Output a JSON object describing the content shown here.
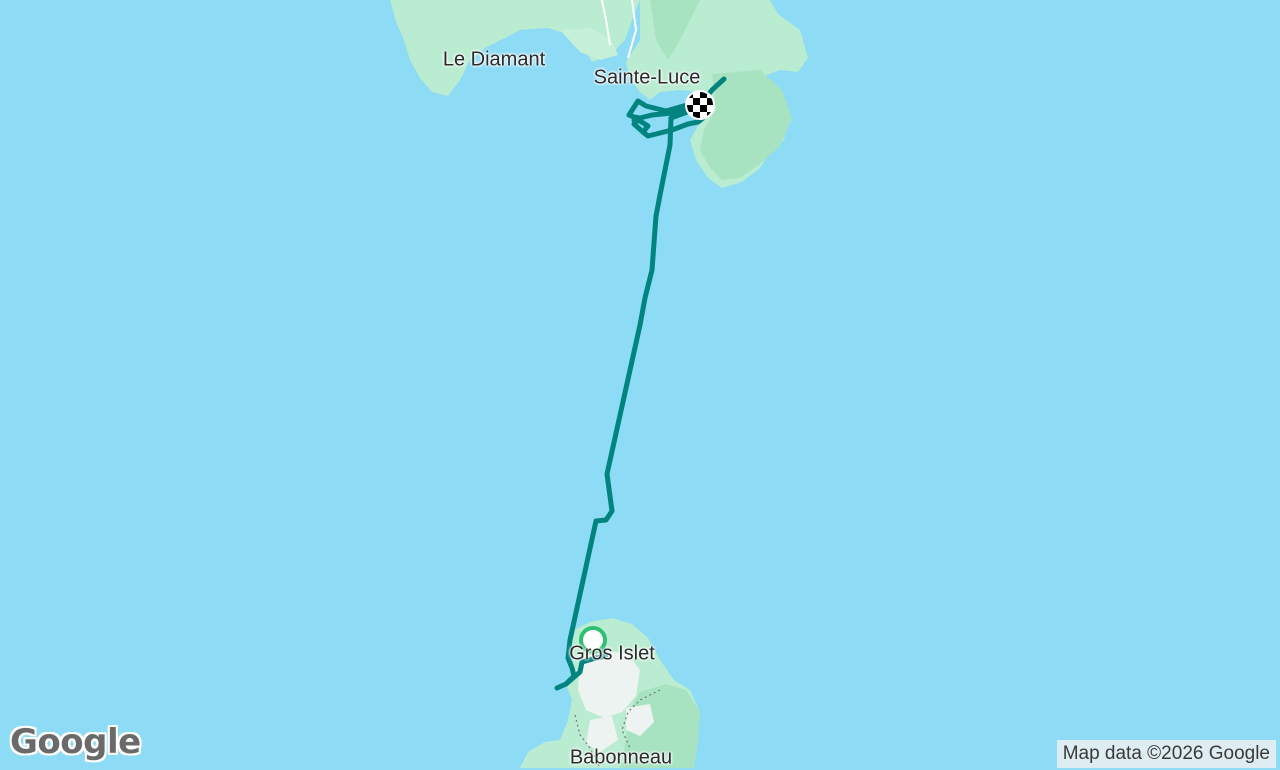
{
  "map": {
    "places": {
      "le_diamant": "Le Diamant",
      "sainte_luce": "Sainte-Luce",
      "gros_islet": "Gros Islet",
      "babonneau": "Babonneau"
    },
    "attribution": "Map data ©2026 Google",
    "logo": "Google",
    "colors": {
      "water": "#8ddbf5",
      "land": "#b9ecd0",
      "land_dark": "#a7e3c1",
      "route": "#00847f",
      "start_marker": "#2fbf71",
      "finish_marker": "#000000"
    },
    "markers": {
      "start": "start-circle-icon",
      "finish": "checkered-flag-icon"
    }
  }
}
